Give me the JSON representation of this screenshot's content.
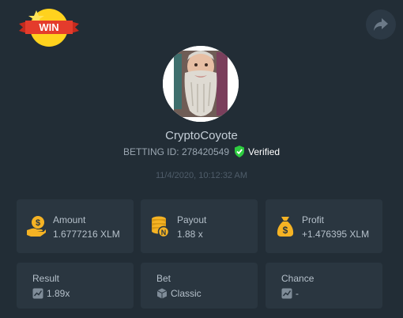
{
  "badge": {
    "text": "WIN"
  },
  "profile": {
    "username": "CryptoCoyote",
    "betting_id": "BETTING ID: 278420549",
    "verified": "Verified",
    "datetime": "11/4/2020, 10:12:32 AM"
  },
  "stats": {
    "amount": {
      "label": "Amount",
      "value": "1.6777216 XLM"
    },
    "payout": {
      "label": "Payout",
      "value": "1.88 x"
    },
    "profit": {
      "label": "Profit",
      "value": "+1.476395 XLM"
    },
    "result": {
      "label": "Result",
      "value": "1.89x"
    },
    "bet": {
      "label": "Bet",
      "value": "Classic"
    },
    "chance": {
      "label": "Chance",
      "value": "-"
    }
  },
  "colors": {
    "background": "#222d36",
    "card": "#2a3640",
    "accent_gold": "#f5b324",
    "verified_green": "#2ecc40",
    "badge_red": "#e43c2c"
  },
  "icons": {
    "share": "share-icon",
    "amount": "money-hand-icon",
    "payout": "coin-stack-icon",
    "profit": "money-bag-icon",
    "result": "dice-chart-icon",
    "bet": "cube-icon",
    "chance": "dice-chart-icon"
  }
}
